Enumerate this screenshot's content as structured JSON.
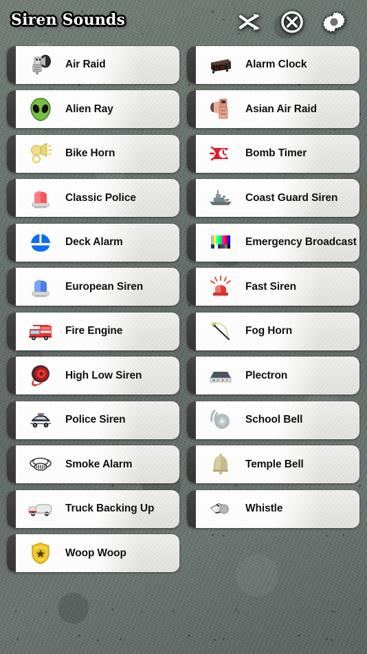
{
  "app": {
    "title": "Siren Sounds",
    "background_color": "#68726d",
    "card_color": "#eaeae7",
    "card_tab_color": "#3d3d3d",
    "label_color": "#111111"
  },
  "header": {
    "title": "Siren Sounds",
    "buttons": [
      {
        "name": "shuffle-button",
        "icon": "shuffle-icon",
        "label": "Shuffle"
      },
      {
        "name": "stop-button",
        "icon": "stop-circle-icon",
        "label": "Stop"
      },
      {
        "name": "settings-button",
        "icon": "gear-icon",
        "label": "Settings"
      }
    ]
  },
  "sounds": [
    {
      "label": "Air Raid",
      "icon": "air-raid-siren-icon"
    },
    {
      "label": "Alarm Clock",
      "icon": "alarm-clock-icon"
    },
    {
      "label": "Alien Ray",
      "icon": "alien-head-icon"
    },
    {
      "label": "Asian Air Raid",
      "icon": "asian-air-raid-siren-icon"
    },
    {
      "label": "Bike Horn",
      "icon": "bike-horn-icon"
    },
    {
      "label": "Bomb Timer",
      "icon": "bomb-timer-icon"
    },
    {
      "label": "Classic Police",
      "icon": "red-police-beacon-icon"
    },
    {
      "label": "Coast Guard Siren",
      "icon": "coast-guard-ship-icon"
    },
    {
      "label": "Deck Alarm",
      "icon": "blue-deck-alarm-icon"
    },
    {
      "label": "Emergency Broadcast",
      "icon": "tv-color-bars-icon"
    },
    {
      "label": "European Siren",
      "icon": "blue-police-beacon-icon"
    },
    {
      "label": "Fast Siren",
      "icon": "flashing-red-beacon-icon"
    },
    {
      "label": "Fire Engine",
      "icon": "fire-engine-icon"
    },
    {
      "label": "Fog Horn",
      "icon": "fog-horn-icon"
    },
    {
      "label": "High Low Siren",
      "icon": "horn-speaker-icon"
    },
    {
      "label": "Plectron",
      "icon": "plectron-receiver-icon"
    },
    {
      "label": "Police Siren",
      "icon": "police-car-icon"
    },
    {
      "label": "School Bell",
      "icon": "school-bell-icon"
    },
    {
      "label": "Smoke Alarm",
      "icon": "smoke-detector-icon"
    },
    {
      "label": "Temple Bell",
      "icon": "temple-bell-icon"
    },
    {
      "label": "Truck Backing Up",
      "icon": "truck-icon"
    },
    {
      "label": "Whistle",
      "icon": "whistle-icon"
    },
    {
      "label": "Woop Woop",
      "icon": "police-badge-icon"
    }
  ]
}
